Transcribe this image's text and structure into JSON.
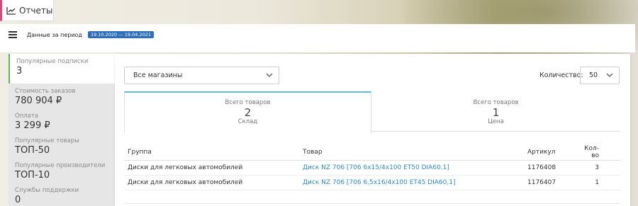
{
  "reports_tab": {
    "label": "Отчеты",
    "icon": "chart-line-icon",
    "accent": "#e8407a"
  },
  "header": {
    "menu_icon": "hamburger-icon",
    "period_label": "Данные за период",
    "period_value": "19.10.2020 — 19.04.2021",
    "period_badge_color": "#2f6fb8"
  },
  "sidebar": {
    "items": [
      {
        "label": "Популярные подписки",
        "value": "3"
      },
      {
        "label": "Стоимость заказов",
        "value": "780 904 ₽"
      },
      {
        "label": "Оплата",
        "value": "3 299 ₽"
      },
      {
        "label": "Популярные товары",
        "value": "ТОП-50"
      },
      {
        "label": "Популярные производители",
        "value": "ТОП-10"
      },
      {
        "label": "Службы поддержки",
        "value": "0"
      }
    ],
    "active_accent": "#5cb85c"
  },
  "filters": {
    "store_select": "Все магазины",
    "quantity_label": "Количество:",
    "quantity_value": "50"
  },
  "summary_tabs": [
    {
      "title": "Всего товаров",
      "value": "2",
      "sub": "Склад"
    },
    {
      "title": "Всего товаров",
      "value": "1",
      "sub": "Цена"
    }
  ],
  "table": {
    "headers": {
      "group": "Группа",
      "product": "Товар",
      "article": "Артикул",
      "qty": "Кол-во"
    },
    "rows": [
      {
        "group": "Диски для легковых автомобилей",
        "product": "Диск NZ 706 [706 6x15/4x100 ET50 DIA60,1]",
        "article": "1176408",
        "qty": "3"
      },
      {
        "group": "Диски для легковых автомобилей",
        "product": "Диск NZ 706 [706 6,5x16/4x100 ET45 DIA60,1]",
        "article": "1176407",
        "qty": "1"
      }
    ],
    "link_color": "#2e8ac8"
  }
}
